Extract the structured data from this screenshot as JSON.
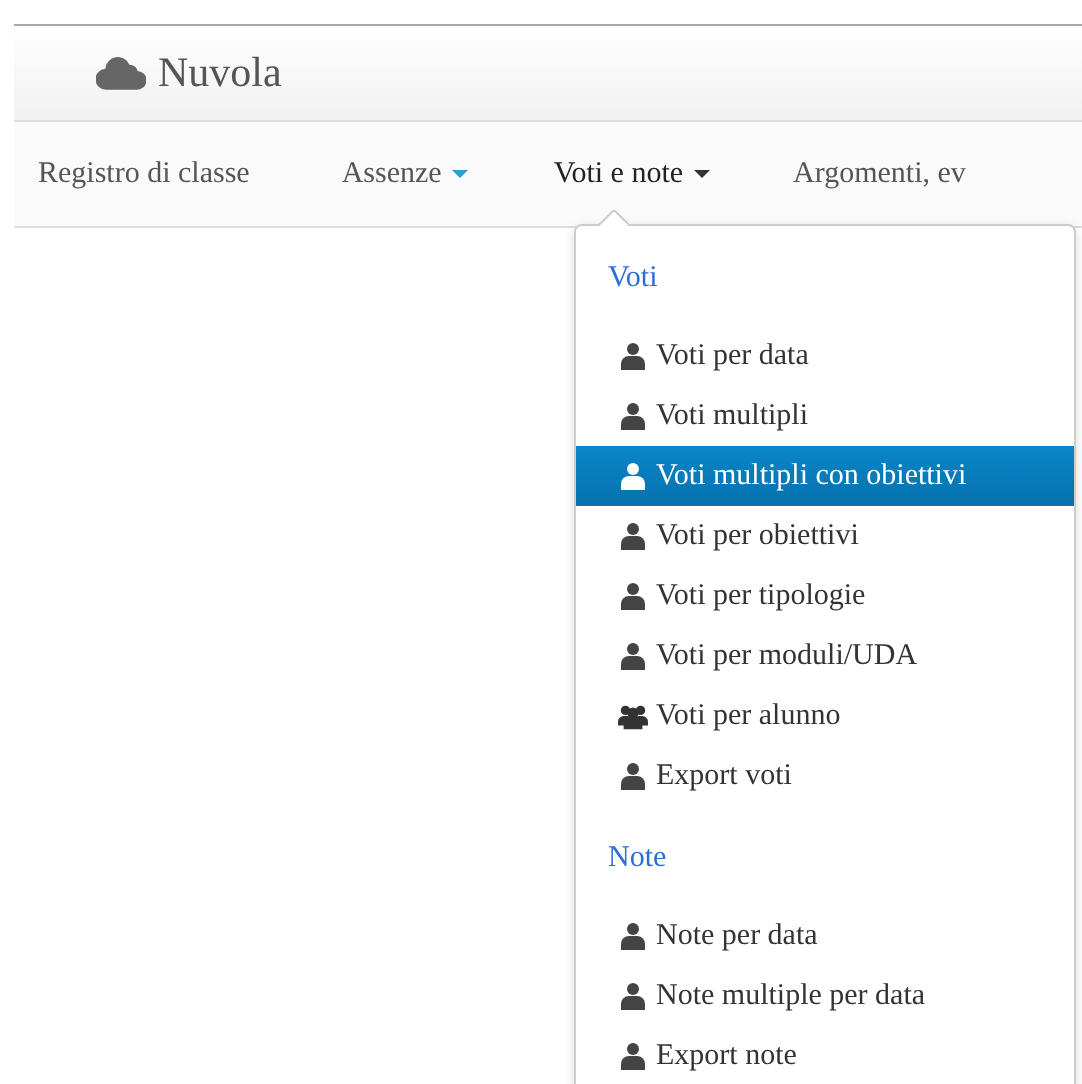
{
  "brand": {
    "title": "Nuvola"
  },
  "nav": [
    {
      "label": "Registro di classe",
      "dropdown": false,
      "selected": false
    },
    {
      "label": "Assenze",
      "dropdown": true,
      "selected": false
    },
    {
      "label": "Voti e note",
      "dropdown": true,
      "selected": true
    },
    {
      "label": "Argomenti, ev",
      "dropdown": false,
      "selected": false
    }
  ],
  "menu": {
    "sections": [
      {
        "header": "Voti",
        "items": [
          {
            "label": "Voti per data",
            "kind": "user",
            "selected": false
          },
          {
            "label": "Voti multipli",
            "kind": "user",
            "selected": false
          },
          {
            "label": "Voti multipli con obiettivi",
            "kind": "user",
            "selected": true
          },
          {
            "label": "Voti per obiettivi",
            "kind": "user",
            "selected": false
          },
          {
            "label": "Voti per tipologie",
            "kind": "user",
            "selected": false
          },
          {
            "label": "Voti per moduli/UDA",
            "kind": "user",
            "selected": false
          },
          {
            "label": "Voti per alunno",
            "kind": "group",
            "selected": false
          },
          {
            "label": "Export voti",
            "kind": "user",
            "selected": false
          }
        ]
      },
      {
        "header": "Note",
        "items": [
          {
            "label": "Note per data",
            "kind": "user",
            "selected": false
          },
          {
            "label": "Note multiple per data",
            "kind": "user",
            "selected": false
          },
          {
            "label": "Export note",
            "kind": "user",
            "selected": false
          }
        ]
      }
    ]
  }
}
